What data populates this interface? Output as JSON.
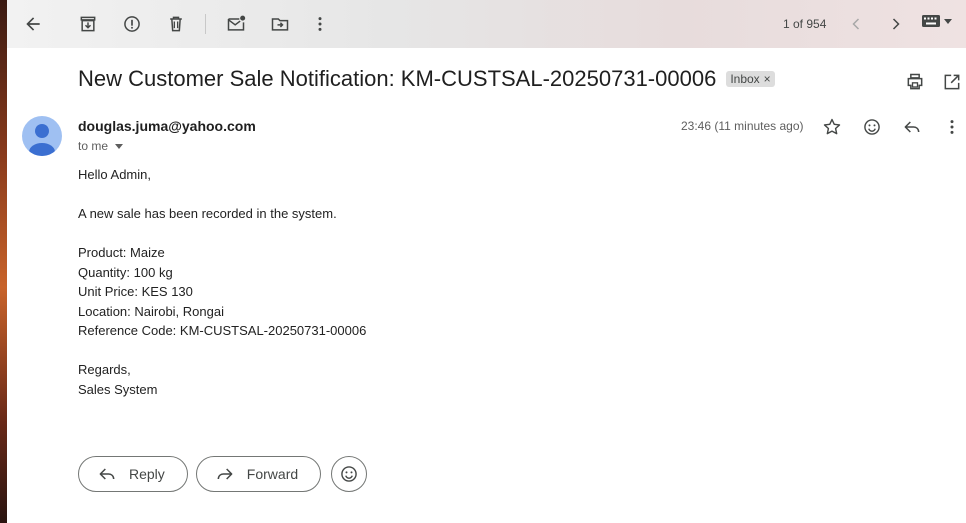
{
  "toolbar": {
    "back_icon": "arrow-back-icon",
    "archive_icon": "archive-icon",
    "spam_icon": "report-spam-icon",
    "delete_icon": "delete-icon",
    "unread_icon": "mark-unread-icon",
    "move_icon": "move-to-folder-icon",
    "more_icon": "more-vert-icon",
    "pager": "1 of 954",
    "keyboard_icon": "keyboard-icon"
  },
  "email": {
    "subject": "New Customer Sale Notification: KM-CUSTSAL-20250731-00006",
    "label": "Inbox",
    "label_close": "×",
    "sender": "douglas.juma@yahoo.com",
    "to": "to me",
    "time": "23:46 (11 minutes ago)",
    "body": {
      "greeting": "Hello Admin,",
      "intro": "A new sale has been recorded in the system.",
      "product": "Product: Maize",
      "quantity": "Quantity: 100 kg",
      "unit_price": "Unit Price: KES 130",
      "location": "Location: Nairobi, Rongai",
      "reference": "Reference Code: KM-CUSTSAL-20250731-00006",
      "regards": "Regards,",
      "signature": "Sales System"
    }
  },
  "actions": {
    "reply_label": "Reply",
    "forward_label": "Forward"
  },
  "colors": {
    "avatar_bg": "#9fc0f2",
    "avatar_fg": "#3b6fd1"
  }
}
